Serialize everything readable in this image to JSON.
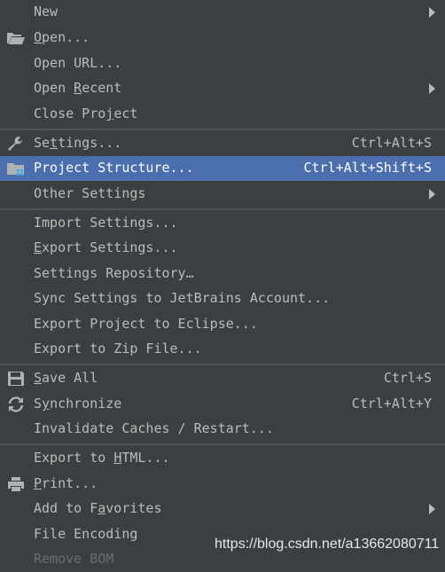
{
  "colors": {
    "menu_background": "#3c3f41",
    "selection": "#4b6eaf",
    "text": "#bbbbbb",
    "separator": "#515151",
    "disabled_text": "#6a6c6e"
  },
  "menu": {
    "new": {
      "label": "New",
      "has_submenu": true
    },
    "open": {
      "pre": "",
      "mn": "O",
      "post": "pen...",
      "icon": "folder-open-icon"
    },
    "open_url": {
      "label": "Open URL..."
    },
    "open_recent": {
      "pre": "Open ",
      "mn": "R",
      "post": "ecent",
      "has_submenu": true
    },
    "close_project": {
      "pre": "Close Pro",
      "mn": "j",
      "post": "ect"
    },
    "settings": {
      "pre": "Se",
      "mn": "t",
      "post": "tings...",
      "shortcut": "Ctrl+Alt+S",
      "icon": "wrench-icon"
    },
    "project_structure": {
      "label": "Project Structure...",
      "shortcut": "Ctrl+Alt+Shift+S",
      "icon": "project-structure-folder-icon",
      "selected": true
    },
    "other_settings": {
      "label": "Other Settings",
      "has_submenu": true
    },
    "import_settings": {
      "label": "Import Settings..."
    },
    "export_settings": {
      "pre": "",
      "mn": "E",
      "post": "xport Settings..."
    },
    "settings_repository": {
      "label": "Settings Repository…"
    },
    "sync_settings": {
      "label": "Sync Settings to JetBrains Account..."
    },
    "export_eclipse": {
      "label": "Export Project to Eclipse..."
    },
    "export_zip": {
      "label": "Export to Zip File..."
    },
    "save_all": {
      "pre": "",
      "mn": "S",
      "post": "ave All",
      "shortcut": "Ctrl+S",
      "icon": "save-icon"
    },
    "synchronize": {
      "pre": "S",
      "mn": "y",
      "post": "nchronize",
      "shortcut": "Ctrl+Alt+Y",
      "icon": "sync-icon"
    },
    "invalidate_caches": {
      "label": "Invalidate Caches / Restart..."
    },
    "export_html": {
      "pre": "Export to ",
      "mn": "H",
      "post": "TML..."
    },
    "print": {
      "pre": "",
      "mn": "P",
      "post": "rint...",
      "icon": "printer-icon"
    },
    "add_favorites": {
      "pre": "Add to F",
      "mn": "a",
      "post": "vorites",
      "has_submenu": true
    },
    "file_encoding": {
      "label": "File Encoding"
    },
    "remove_bom": {
      "label": "Remove BOM",
      "disabled": true
    }
  },
  "watermark": "https://blog.csdn.net/a13662080711"
}
